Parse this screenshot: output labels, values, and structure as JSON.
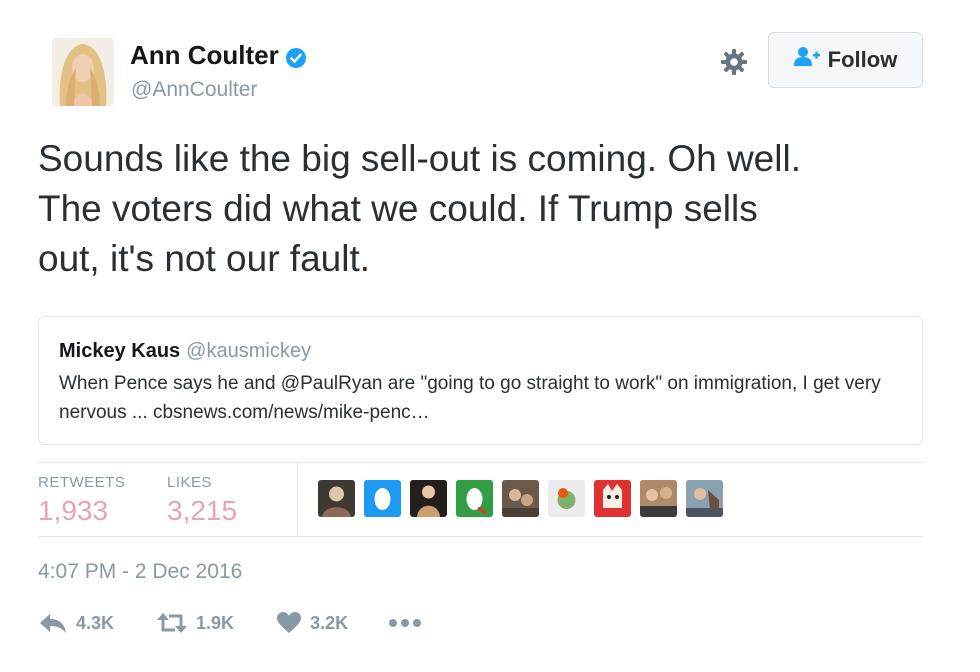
{
  "user": {
    "name": "Ann Coulter",
    "handle": "@AnnCoulter"
  },
  "header": {
    "follow_label": "Follow"
  },
  "tweet": {
    "text": "Sounds like the big sell-out is coming.  Oh well.\nThe voters did what we could.  If Trump sells\nout, it's not our fault."
  },
  "quoted_tweet": {
    "name": "Mickey Kaus",
    "handle": "@kausmickey",
    "text": "When Pence says he and @PaulRyan are \"going to go straight to work\" on immigration, I get very nervous ... cbsnews.com/news/mike-penc…"
  },
  "stats": {
    "retweets_label": "RETWEETS",
    "retweets_value": "1,933",
    "likes_label": "LIKES",
    "likes_value": "3,215"
  },
  "timestamp": "4:07 PM - 2 Dec 2016",
  "actions": {
    "reply_count": "4.3K",
    "retweet_count": "1.9K",
    "like_count": "3.2K"
  },
  "colors": {
    "accent": "#1da1f2",
    "stat_value": "#e8a4b3",
    "muted": "#8899a6"
  },
  "icons": [
    "verified-badge-icon",
    "gear-icon",
    "follow-person-icon",
    "reply-icon",
    "retweet-icon",
    "heart-icon",
    "more-icon"
  ]
}
